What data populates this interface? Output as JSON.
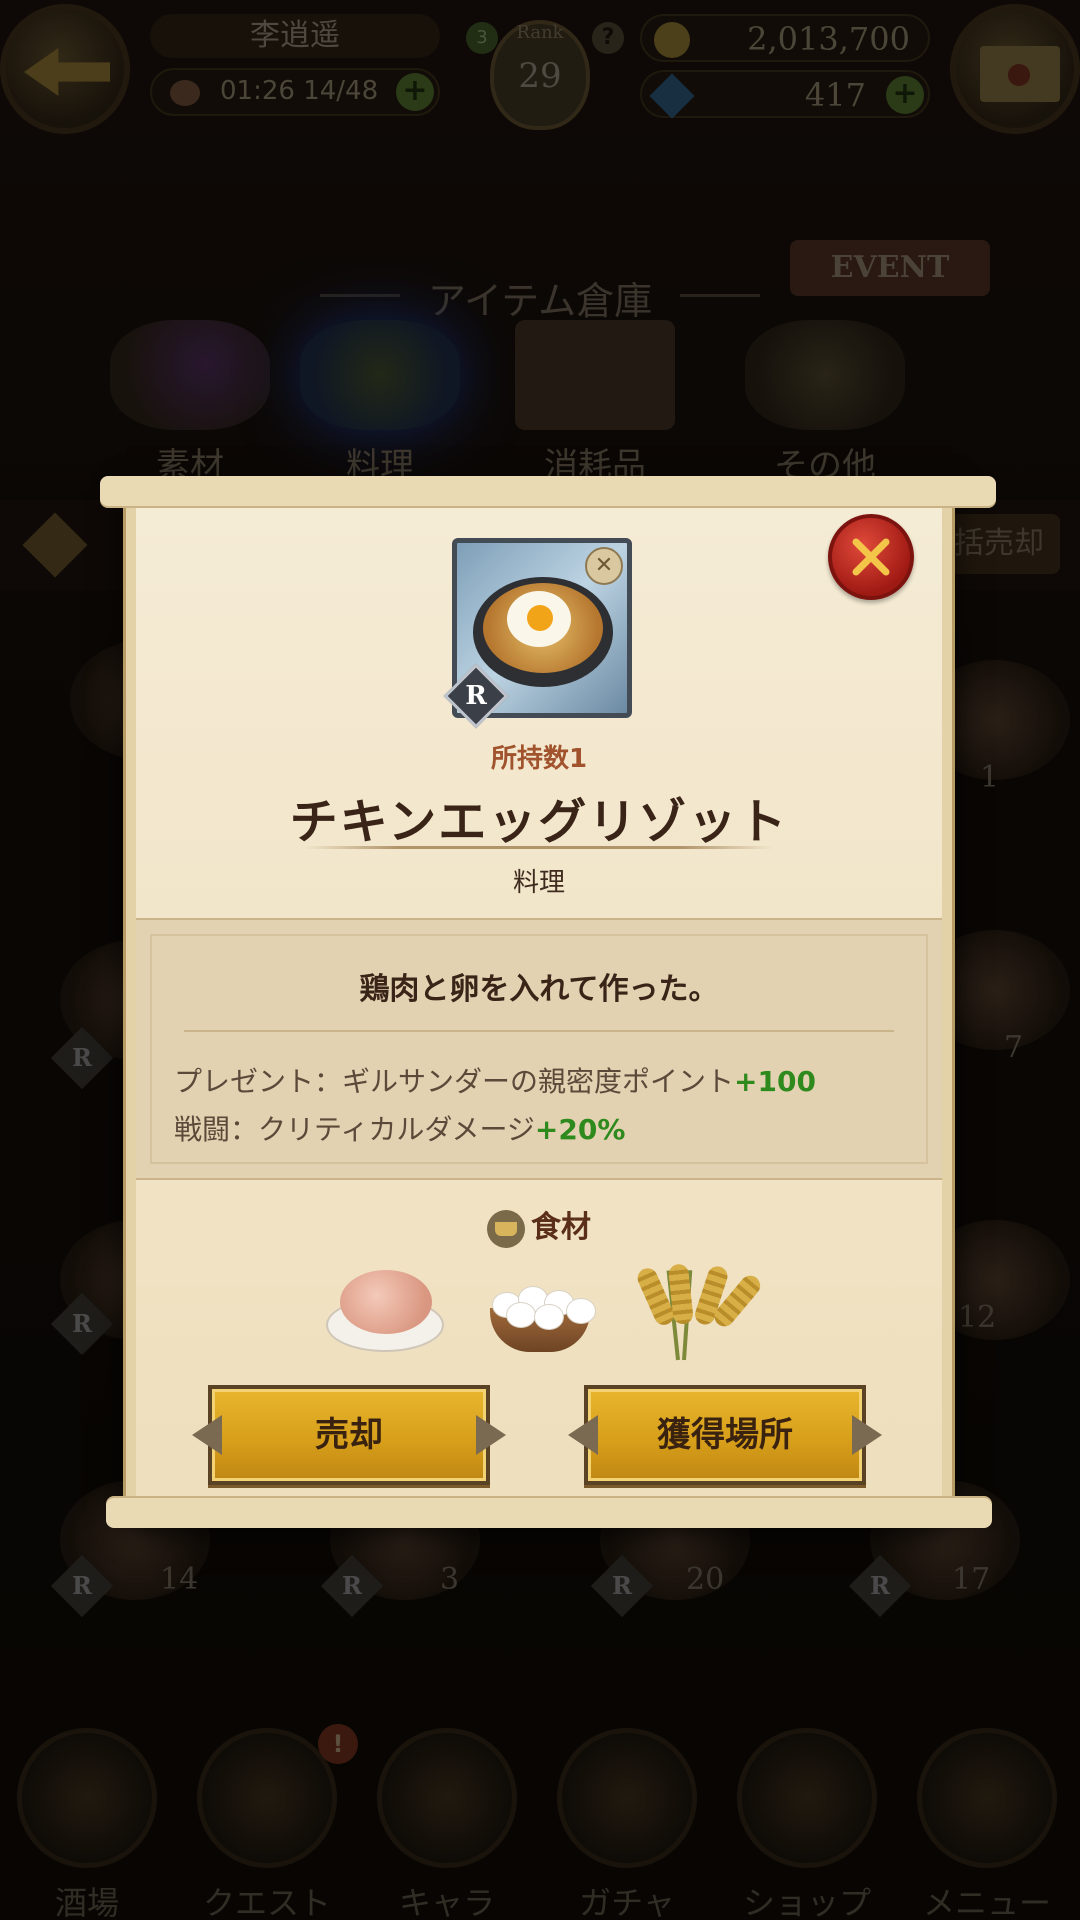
{
  "header": {
    "player_name": "李逍遥",
    "stamina_timer": "01:26",
    "stamina": "14/48",
    "rank_label": "Rank",
    "rank": "29",
    "rank_sub": "3",
    "gold": "2,013,700",
    "gems": "417"
  },
  "storage": {
    "title": "アイテム倉庫",
    "event_label": "EVENT",
    "tabs": [
      {
        "label": "素材"
      },
      {
        "label": "料理"
      },
      {
        "label": "消耗品"
      },
      {
        "label": "その他"
      }
    ],
    "bulk_sell_label": "括売却",
    "item_counts": [
      "1",
      "7",
      "12",
      "14",
      "3",
      "20",
      "17"
    ]
  },
  "dialog": {
    "owned": "所持数1",
    "name": "チキンエッグリゾット",
    "rarity": "R",
    "category": "料理",
    "description": "鶏肉と卵を入れて作った。",
    "effects": [
      {
        "label": "プレゼント：ギルサンダーの親密度ポイント",
        "value": "+100"
      },
      {
        "label": "戦闘：クリティカルダメージ",
        "value": "+20%"
      }
    ],
    "ingredients_label": "食材",
    "ingredients": [
      "chicken-icon",
      "eggs-icon",
      "rice-plant-icon"
    ],
    "sell_label": "売却",
    "source_label": "獲得場所"
  },
  "bottom_nav": [
    {
      "label": "酒場"
    },
    {
      "label": "クエスト"
    },
    {
      "label": "キャラ"
    },
    {
      "label": "ガチャ"
    },
    {
      "label": "ショップ"
    },
    {
      "label": "メニュー"
    }
  ],
  "colors": {
    "gold_button": "#d8a01a",
    "close_button": "#c0241c",
    "effect_value": "#2f8a1e",
    "owned_text": "#a0532c"
  }
}
